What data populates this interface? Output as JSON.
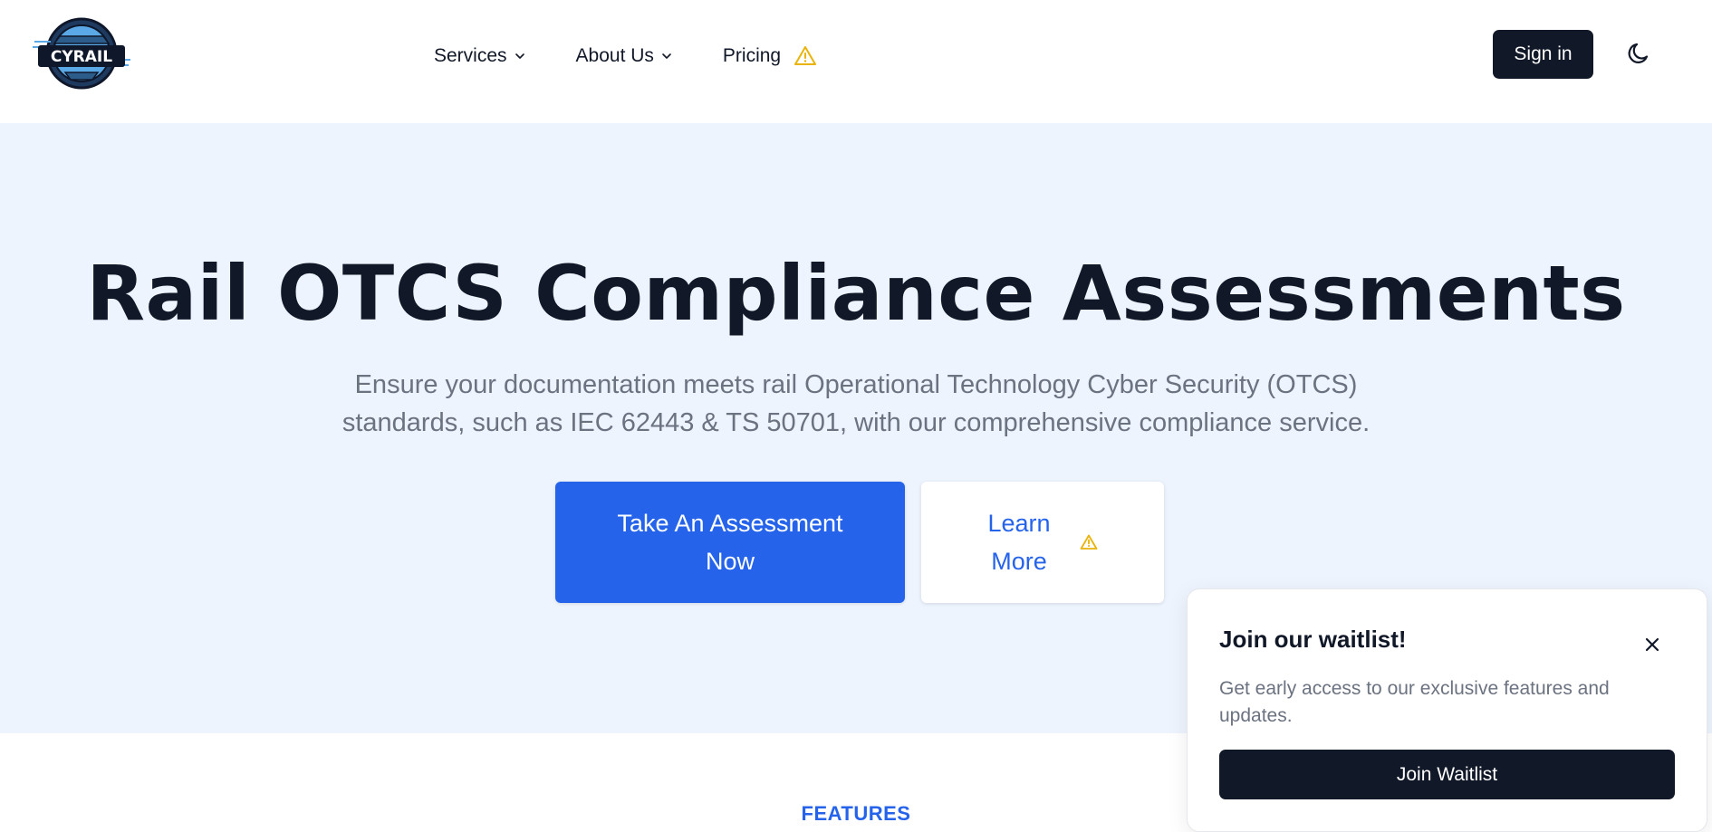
{
  "header": {
    "logo_text": "CYRAIL",
    "nav": [
      {
        "label": "Services",
        "icon": "chevron-down-icon"
      },
      {
        "label": "About Us",
        "icon": "chevron-down-icon"
      },
      {
        "label": "Pricing",
        "icon": "warning-icon"
      }
    ],
    "signin_label": "Sign in",
    "theme_icon": "moon-icon"
  },
  "hero": {
    "title": "Rail OTCS Compliance Assessments",
    "subtitle_line1": "Ensure your documentation meets rail Operational Technology Cyber Security (OTCS)",
    "subtitle_line2": "standards, such as IEC 62443 & TS 50701, with our comprehensive compliance service.",
    "primary_button": "Take An Assessment Now",
    "secondary_button": "Learn More"
  },
  "features": {
    "label": "FEATURES"
  },
  "waitlist_popup": {
    "title": "Join our waitlist!",
    "text": "Get early access to our exclusive features and updates.",
    "button": "Join Waitlist"
  },
  "colors": {
    "primary": "#2563eb",
    "dark": "#111827",
    "hero_bg": "#eef4fe",
    "muted": "#6b7280",
    "warning": "#eab308"
  }
}
